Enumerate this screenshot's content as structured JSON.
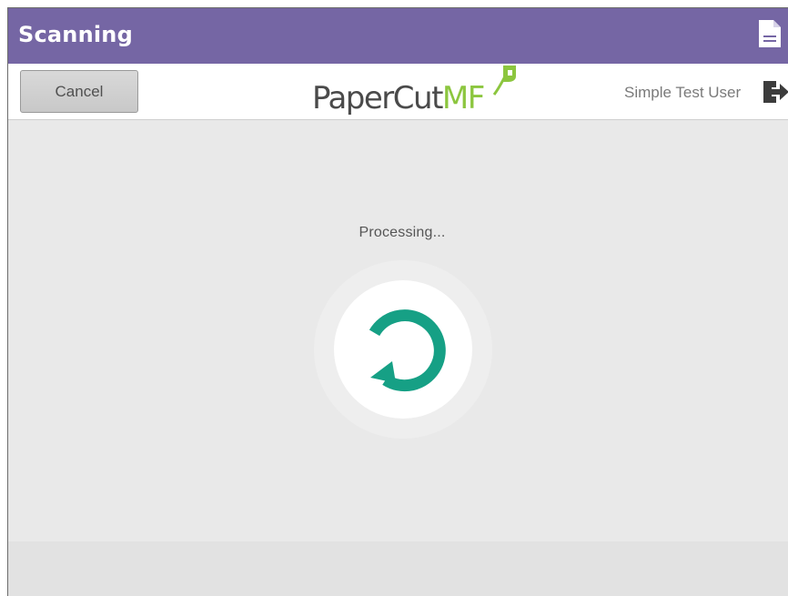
{
  "titlebar": {
    "title": "Scanning",
    "icon": "document-icon"
  },
  "header": {
    "cancel_label": "Cancel",
    "logo": {
      "part1": "PaperCut",
      "part2": "MF"
    },
    "user_name": "Simple Test User",
    "logout_icon": "logout-icon"
  },
  "main": {
    "status_text": "Processing...",
    "spinner_icon": "refresh-icon"
  },
  "colors": {
    "titlebar_bg": "#7566a4",
    "accent_teal": "#16a085",
    "logo_green": "#8cc63f"
  }
}
